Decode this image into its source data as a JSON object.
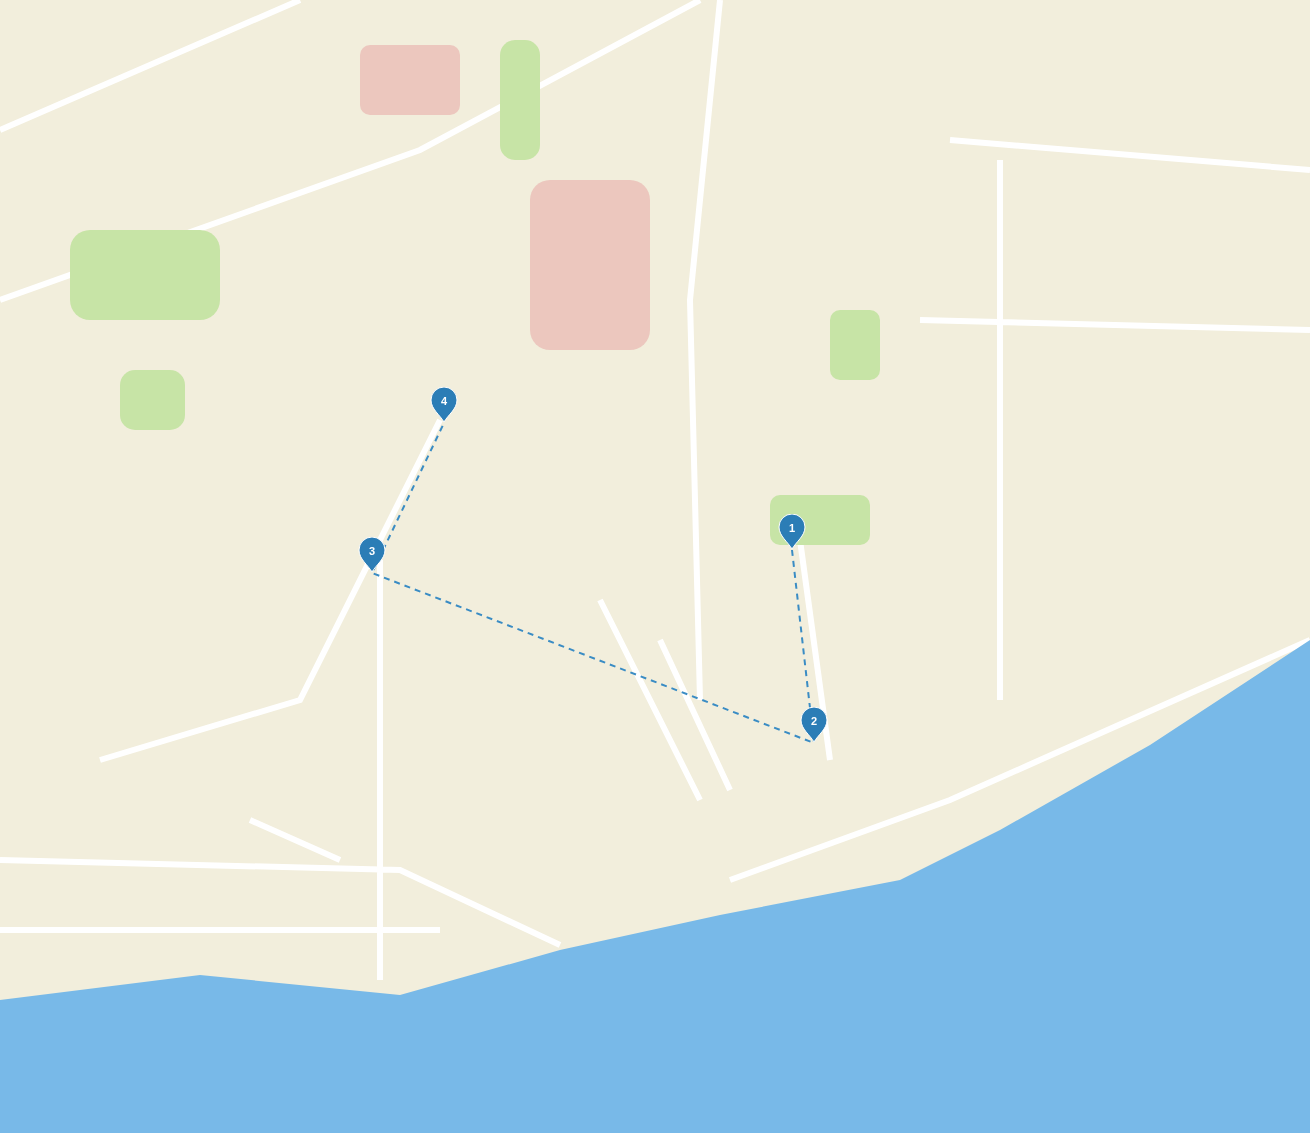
{
  "map": {
    "markers": [
      {
        "label": "1"
      },
      {
        "label": "2"
      },
      {
        "label": "3"
      },
      {
        "label": "4"
      }
    ]
  }
}
